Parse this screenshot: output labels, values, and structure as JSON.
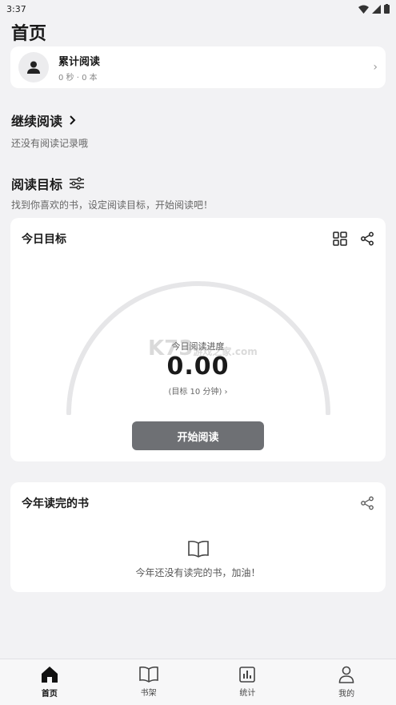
{
  "status_bar": {
    "time": "3:37"
  },
  "page_title": "首页",
  "account": {
    "name": "累计阅读",
    "summary": "0 秒 · 0 本"
  },
  "continue_reading": {
    "title": "继续阅读",
    "empty_text": "还没有阅读记录哦"
  },
  "reading_goal": {
    "title": "阅读目标",
    "subtitle": "找到你喜欢的书，设定阅读目标，开始阅读吧！"
  },
  "today_goal": {
    "title": "今日目标",
    "progress_label": "今日阅读进度",
    "progress_value": "0.00",
    "target_text": "(目标 10 分钟) ›",
    "start_button": "开始阅读",
    "progress_fraction": 0
  },
  "books_finished": {
    "title": "今年读完的书",
    "empty_text": "今年还没有读完的书，加油！"
  },
  "watermark": {
    "main": "K73",
    "sub": "游戏之家",
    "domain": ".com"
  },
  "nav": [
    {
      "label": "首页",
      "icon": "home-icon",
      "active": true
    },
    {
      "label": "书架",
      "icon": "book-icon",
      "active": false
    },
    {
      "label": "统计",
      "icon": "stats-icon",
      "active": false
    },
    {
      "label": "我的",
      "icon": "user-icon",
      "active": false
    }
  ],
  "colors": {
    "background": "#f2f2f4",
    "button": "#6e7074",
    "gauge_track": "#e6e6e8"
  }
}
